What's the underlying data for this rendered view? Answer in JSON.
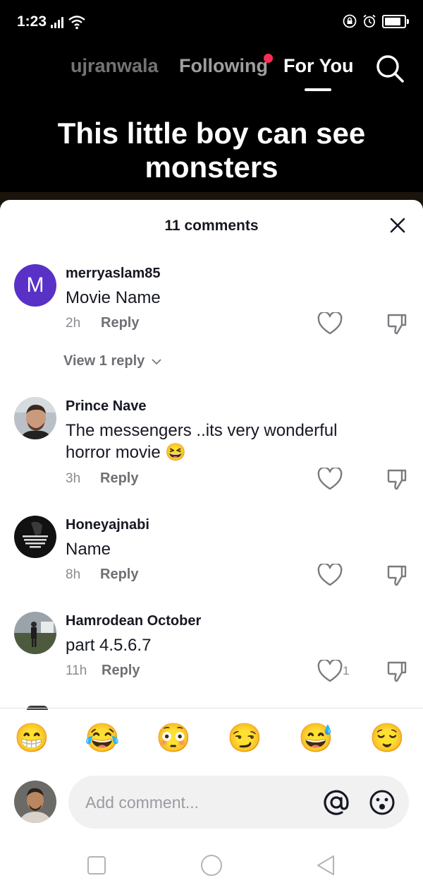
{
  "status_bar": {
    "time": "1:23",
    "battery_level": 0.85
  },
  "top_nav": {
    "tabs": [
      {
        "label": "ujranwala",
        "active": false
      },
      {
        "label": "Following",
        "active": false,
        "has_notification": true
      },
      {
        "label": "For You",
        "active": true
      }
    ],
    "search_icon": "search-icon"
  },
  "video": {
    "caption": "This little boy can see monsters"
  },
  "sheet": {
    "title": "11 comments",
    "close_icon": "close-icon"
  },
  "comments": [
    {
      "username": "merryaslam85",
      "avatar_letter": "M",
      "text": "Movie Name",
      "time": "2h",
      "reply_label": "Reply",
      "likes": "",
      "view_replies": "View 1 reply"
    },
    {
      "username": "Prince Nave",
      "text": "The messengers ..its very wonderful horror movie 😆",
      "time": "3h",
      "reply_label": "Reply",
      "likes": ""
    },
    {
      "username": "Honeyajnabi",
      "text": "Name",
      "time": "8h",
      "reply_label": "Reply",
      "likes": ""
    },
    {
      "username": "Hamrodean October",
      "text": "part 4.5.6.7",
      "time": "11h",
      "reply_label": "Reply",
      "likes": "1"
    }
  ],
  "emoji_bar": [
    "😁",
    "😂",
    "😳",
    "😏",
    "😅",
    "😌"
  ],
  "composer": {
    "placeholder": "Add comment...",
    "mention_icon": "at-icon",
    "emoji_icon": "emoji-face-icon"
  },
  "accent_color": "#fe2c55"
}
